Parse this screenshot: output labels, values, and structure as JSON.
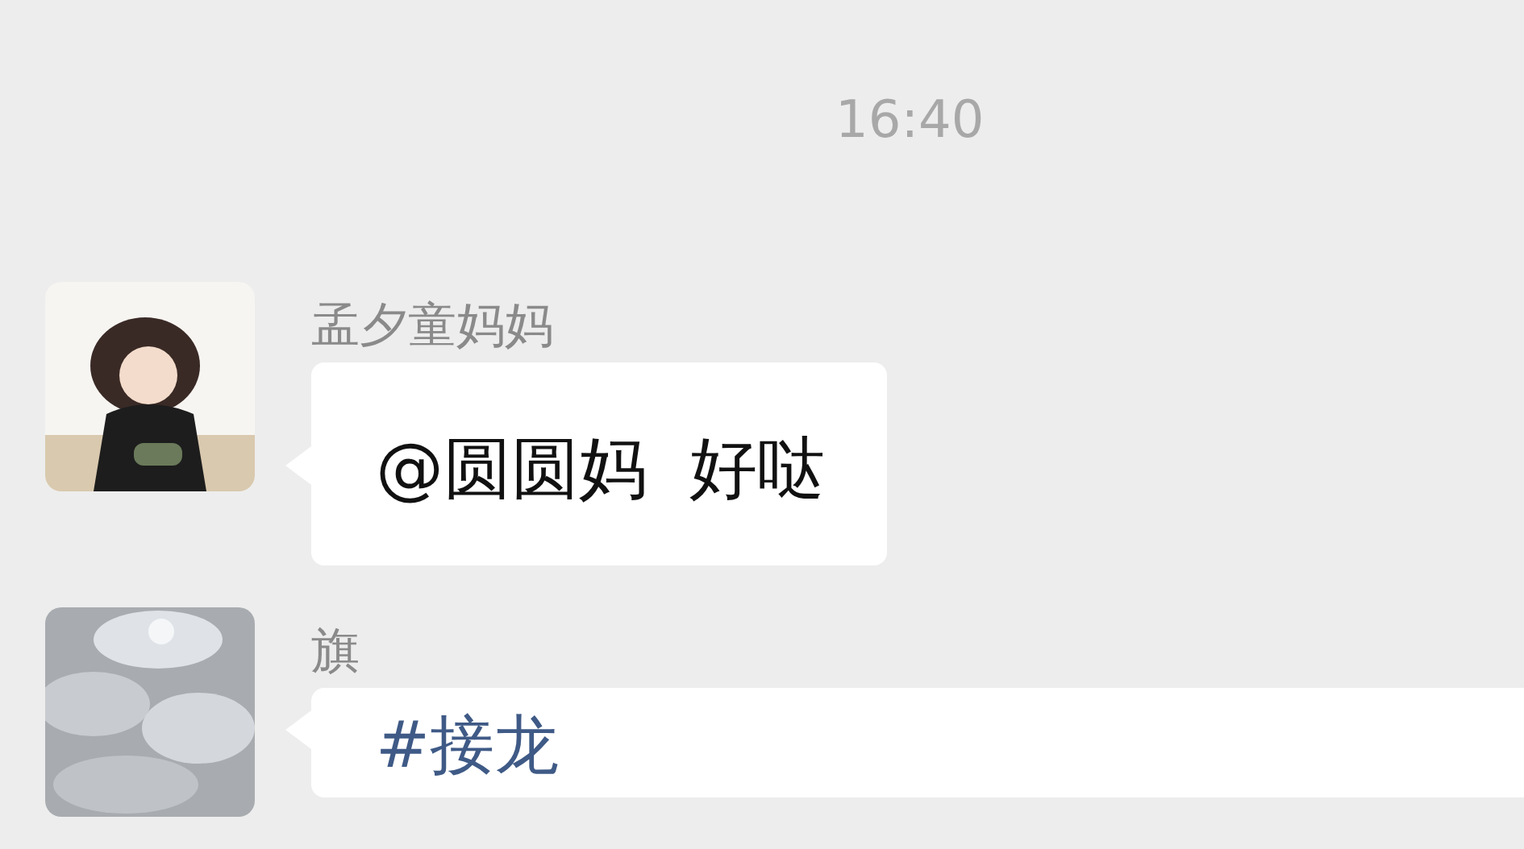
{
  "time": "16:40",
  "messages": [
    {
      "sender": "孟夕童妈妈",
      "text": "@圆圆妈  好哒",
      "kind": "plain"
    },
    {
      "sender": "旗",
      "text": "#接龙",
      "kind": "tag"
    }
  ]
}
